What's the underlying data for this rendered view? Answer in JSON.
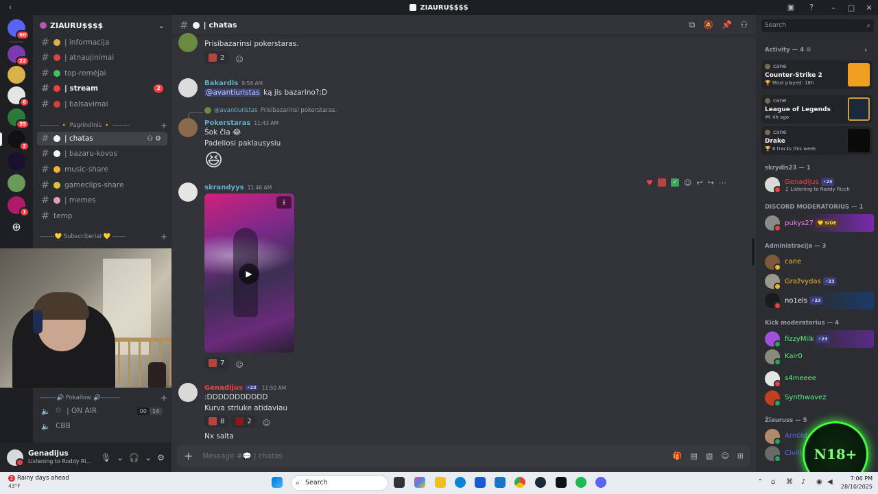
{
  "titlebar": {
    "title": "ZIAURU$$$$"
  },
  "servers": {
    "badges": [
      "60",
      "22",
      "6",
      "55",
      "2",
      "1"
    ]
  },
  "guild": {
    "name": "ZIAURU$$$$"
  },
  "channels": {
    "top": [
      {
        "label": "| informacija"
      },
      {
        "label": "| atnaujinimai"
      },
      {
        "label": "top-remėjai"
      },
      {
        "label": "| stream",
        "badge": "2"
      },
      {
        "label": "| balsavimai"
      }
    ],
    "category_main": "--------- 🔸 Pagrindinis 🔸 --------",
    "main": [
      {
        "label": "| chatas"
      },
      {
        "label": "| bazaru-kovos"
      },
      {
        "label": "music-share"
      },
      {
        "label": "gameclips-share"
      },
      {
        "label": "| memes"
      },
      {
        "label": "temp"
      }
    ],
    "category_subs": "-------💛 Subscriberiai 💛 ------",
    "category_voice": "--------🔊 Pokalbiai 🔊---------",
    "voice": [
      {
        "label": "| ON AIR",
        "count_a": "00",
        "count_b": "14"
      },
      {
        "label": "CBB"
      }
    ]
  },
  "user": {
    "name": "Genadijus",
    "status": "Listening to Roddy Ri..."
  },
  "chat": {
    "channel": "| chatas",
    "messages": [
      {
        "text": "Prisibazarinsi pokerstaras.",
        "reaction_count": "2"
      },
      {
        "author": "Bakardis",
        "time": "9:58 AM",
        "mention": "@avantiuristas",
        "text": " ką jis bazarino?;D"
      },
      {
        "reply_author": "@avantiuristas",
        "reply_text": "Prisibazarinsi pokerstaras.",
        "author": "Pokerstaras",
        "time": "11:43 AM",
        "line1": "Šok čia 😂",
        "line2": "Padeliosi paklausysiu",
        "emoji": "😆"
      },
      {
        "author": "skrandyys",
        "time": "11:46 AM",
        "reaction_count": "7"
      },
      {
        "author": "Genadijus",
        "badge": "⚡23",
        "time": "11:50 AM",
        "line1": ":DDDDDDDDDDD",
        "line2": "Kurva striuke atidaviau",
        "reaction_a": "8",
        "reaction_b": "2",
        "line3": "Nx salta"
      }
    ],
    "composer_placeholder": "Message #💬 | chatas"
  },
  "members": {
    "search_placeholder": "Search",
    "activity_header": "Activity — 4 ⚙",
    "activities": [
      {
        "user": "cane",
        "game": "Counter-Strike 2",
        "meta": "🏆 Most played: 18h"
      },
      {
        "user": "cane",
        "game": "League of Legends",
        "meta": "🎮 4h ago"
      },
      {
        "user": "cane",
        "game": "Drake",
        "meta": "🏆 6 tracks this week"
      }
    ],
    "groups": [
      {
        "header": "skrydis23 — 1",
        "members": [
          {
            "name": "Genadijus",
            "tag": "⚡23",
            "sub": "♫ Listening to Roddy Ricch",
            "color": "#f23f43"
          }
        ]
      },
      {
        "header": "DISCORD MODERATORIUS — 1",
        "members": [
          {
            "name": "pukys27",
            "tag": "💛 SIDE",
            "color": "#f47fff"
          }
        ]
      },
      {
        "header": "Administracija — 3",
        "members": [
          {
            "name": "cane",
            "color": "#f0b232"
          },
          {
            "name": "Gražvydas",
            "tag": "⚡23",
            "color": "#f0b232"
          },
          {
            "name": "no1els",
            "tag": "⚡23",
            "color": "#f2f3f5"
          }
        ]
      },
      {
        "header": "Kick moderatorius — 4",
        "members": [
          {
            "name": "fizzyMilk",
            "tag": "⚡23",
            "color": "#57f287"
          },
          {
            "name": "Kair0",
            "color": "#57f287"
          },
          {
            "name": "s4meeee",
            "color": "#57f287"
          },
          {
            "name": "Synthwavez",
            "color": "#57f287"
          }
        ]
      },
      {
        "header": "Žiauruss — 5",
        "members": [
          {
            "name": "Arn0ld",
            "color": "#5865f2"
          },
          {
            "name": "Civili",
            "color": "#5865f2"
          }
        ]
      }
    ]
  },
  "overlay": {
    "label": "N18+"
  },
  "taskbar": {
    "weather_title": "Rainy days ahead",
    "weather_temp": "43°F",
    "weather_badge": "2",
    "search": "Search",
    "time": "7:06 PM",
    "date": "28/10/2025"
  },
  "colors": {
    "accent": "#5865f2",
    "bg": "#313338",
    "sidebar": "#2b2d31",
    "danger": "#f23f43",
    "online": "#23a55a"
  }
}
